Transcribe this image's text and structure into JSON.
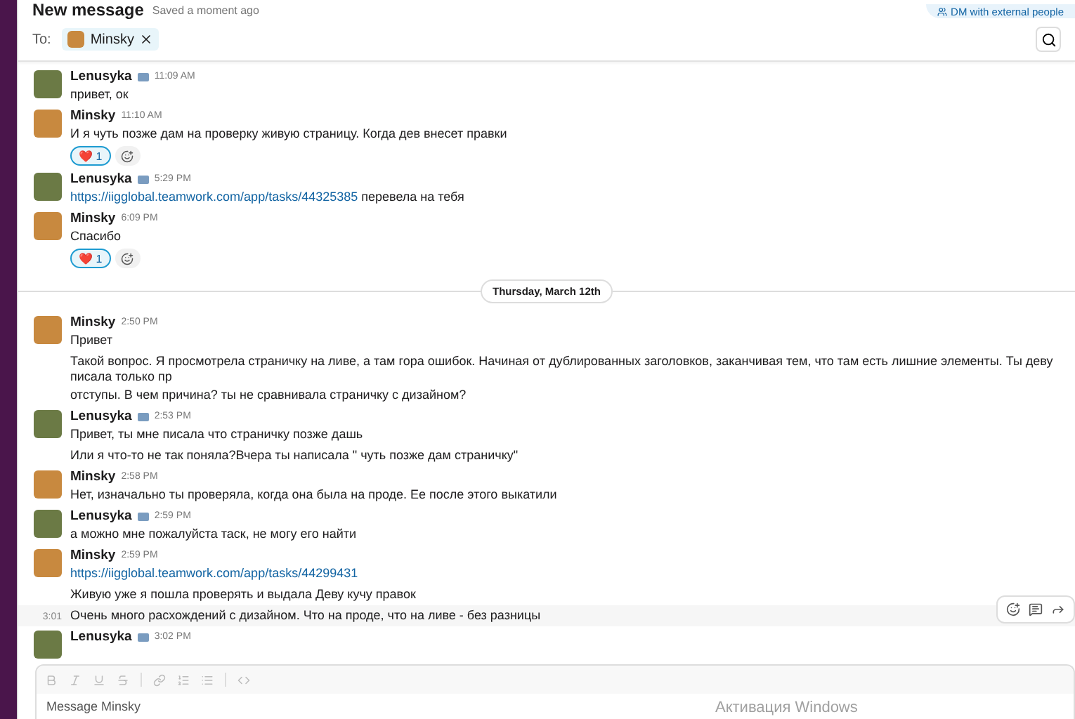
{
  "header": {
    "title": "New message",
    "status": "Saved a moment ago",
    "external_button": "DM with external people"
  },
  "to": {
    "label": "To:",
    "recipient": "Minsky"
  },
  "messages": [
    {
      "kind": "message",
      "author": "Lenusyka",
      "badge": true,
      "time": "11:09 AM",
      "parts": [
        {
          "kind": "text",
          "text": "привет, ок"
        }
      ]
    },
    {
      "kind": "message",
      "author": "Minsky",
      "time": "11:10 AM",
      "parts": [
        {
          "kind": "text",
          "text": "И я чуть позже дам на проверку живую страницу. Когда дев внесет правки"
        }
      ],
      "reactions": [
        {
          "emoji": "❤️",
          "count": "1",
          "selected": true
        }
      ]
    },
    {
      "kind": "message",
      "author": "Lenusyka",
      "badge": true,
      "time": "5:29 PM",
      "parts": [
        {
          "kind": "link",
          "text": "https://iigglobal.teamwork.com/app/tasks/44325385"
        },
        {
          "kind": "text",
          "text": " перевела на тебя"
        }
      ]
    },
    {
      "kind": "message",
      "author": "Minsky",
      "time": "6:09 PM",
      "parts": [
        {
          "kind": "text",
          "text": "Спасибо"
        }
      ],
      "reactions": [
        {
          "emoji": "❤️",
          "count": "1",
          "selected": true
        }
      ]
    },
    {
      "kind": "divider",
      "text": "Thursday, March 12th"
    },
    {
      "kind": "message",
      "author": "Minsky",
      "time": "2:50 PM",
      "parts": [
        {
          "kind": "text",
          "text": "Привет"
        }
      ]
    },
    {
      "kind": "continuation",
      "parts": [
        {
          "kind": "text",
          "text": "Такой вопрос. Я просмотрела страничку на ливе, а там гора ошибок. Начиная от дублированных заголовков, заканчивая тем, что там есть лишние элементы. Ты деву писала только пр"
        }
      ],
      "extra_line": "отступы. В чем причина? ты не сравнивала страничку с дизайном?"
    },
    {
      "kind": "message",
      "author": "Lenusyka",
      "badge": true,
      "time": "2:53 PM",
      "parts": [
        {
          "kind": "text",
          "text": "Привет, ты мне писала что страничку позже дашь"
        }
      ]
    },
    {
      "kind": "continuation",
      "parts": [
        {
          "kind": "text",
          "text": "Или я что-то не так поняла?Вчера ты написала \" чуть позже дам страничку\""
        }
      ]
    },
    {
      "kind": "message",
      "author": "Minsky",
      "time": "2:58 PM",
      "parts": [
        {
          "kind": "text",
          "text": "Нет, изначально ты проверяла, когда она была на проде. Ее после этого выкатили"
        }
      ]
    },
    {
      "kind": "message",
      "author": "Lenusyka",
      "badge": true,
      "time": "2:59 PM",
      "parts": [
        {
          "kind": "text",
          "text": "а можно мне пожалуйста таск, не могу его найти"
        }
      ]
    },
    {
      "kind": "message",
      "author": "Minsky",
      "time": "2:59 PM",
      "parts": [
        {
          "kind": "link",
          "text": "https://iigglobal.teamwork.com/app/tasks/44299431"
        }
      ]
    },
    {
      "kind": "continuation",
      "parts": [
        {
          "kind": "text",
          "text": "Живую уже я пошла проверять и выдала Деву кучу правок"
        }
      ]
    },
    {
      "kind": "continuation",
      "hovered": true,
      "time": "3:01",
      "parts": [
        {
          "kind": "text",
          "text": "Очень много расхождений с дизайном. Что на проде, что на ливе - без разницы"
        }
      ]
    },
    {
      "kind": "message",
      "author": "Lenusyka",
      "badge": true,
      "time": "3:02 PM"
    }
  ],
  "composer": {
    "placeholder": "Message Minsky"
  },
  "overlay_text": "Активация Windows"
}
